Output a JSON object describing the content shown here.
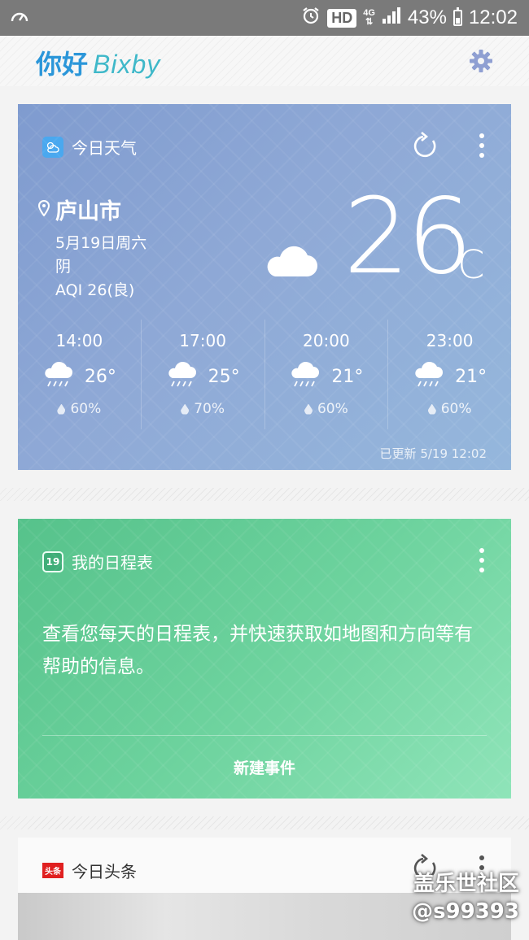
{
  "status_bar": {
    "hd": "HD",
    "network": "4G",
    "battery_percent": "43%",
    "battery_level": 0.43,
    "time": "12:02"
  },
  "header": {
    "greeting": "你好",
    "brand": "Bixby",
    "settings_icon": "gear-icon",
    "accent": "#2b96d9"
  },
  "weather": {
    "title": "今日天气",
    "city": "庐山市",
    "date": "5月19日周六",
    "condition": "阴",
    "aqi": "AQI 26(良)",
    "temp": "26",
    "unit": "C",
    "degree_symbol": "°",
    "hourly": [
      {
        "time": "14:00",
        "temp": "26°",
        "rain": "60%"
      },
      {
        "time": "17:00",
        "temp": "25°",
        "rain": "70%"
      },
      {
        "time": "20:00",
        "temp": "21°",
        "rain": "60%"
      },
      {
        "time": "23:00",
        "temp": "21°",
        "rain": "60%"
      }
    ],
    "updated": "已更新 5/19 12:02",
    "colors": {
      "start": "#7f9bcf",
      "end": "#95b7dc"
    }
  },
  "schedule": {
    "title": "我的日程表",
    "icon_day": "19",
    "body": "查看您每天的日程表，并快速获取如地图和方向等有帮助的信息。",
    "new_event": "新建事件",
    "colors": {
      "start": "#56c28b",
      "end": "#8fe4b9"
    }
  },
  "news": {
    "badge": "头条",
    "title": "今日头条"
  },
  "watermark": {
    "line1": "盖乐世社区",
    "line2": "@s99393"
  }
}
